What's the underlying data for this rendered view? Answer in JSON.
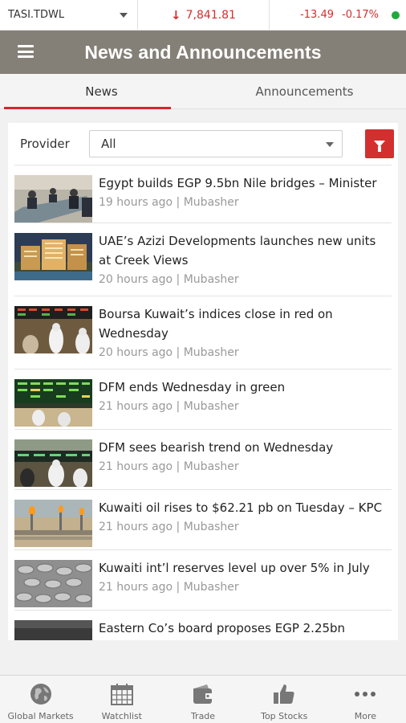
{
  "ticker": {
    "symbol": "TASI.TDWL",
    "index_value": "7,841.81",
    "change": "-13.49",
    "change_pct": "-0.17%",
    "down_color": "#d32f2f",
    "status_color": "#22a83a"
  },
  "appbar": {
    "title": "News and Announcements",
    "background": "#858077"
  },
  "tabs": [
    {
      "label": "News",
      "active": true
    },
    {
      "label": "Announcements",
      "active": false
    }
  ],
  "filter": {
    "provider_label": "Provider",
    "provider_value": "All"
  },
  "news": [
    {
      "headline": "Egypt builds EGP 9.5bn Nile bridges – Minister",
      "meta": "19 hours ago | Mubasher",
      "icon": "meeting-photo"
    },
    {
      "headline": "UAE’s Azizi Developments launches new units at Creek Views",
      "meta": "20 hours ago | Mubasher",
      "icon": "building-photo"
    },
    {
      "headline": "Boursa Kuwait’s indices close in red on Wednesday",
      "meta": "20 hours ago | Mubasher",
      "icon": "trading-floor-photo"
    },
    {
      "headline": "DFM ends Wednesday in green",
      "meta": "21 hours ago | Mubasher",
      "icon": "stock-board-photo"
    },
    {
      "headline": "DFM sees bearish trend on Wednesday",
      "meta": "21 hours ago | Mubasher",
      "icon": "stock-board-photo"
    },
    {
      "headline": "Kuwaiti oil rises to $62.21 pb on Tuesday – KPC",
      "meta": "21 hours ago | Mubasher",
      "icon": "oil-field-photo"
    },
    {
      "headline": "Kuwaiti int’l reserves level up over 5% in July",
      "meta": "21 hours ago | Mubasher",
      "icon": "coins-photo"
    },
    {
      "headline": "Eastern Co’s board proposes EGP 2.25bn",
      "meta": "",
      "icon": "factory-photo"
    }
  ],
  "bottom_nav": [
    {
      "label": "Global Markets",
      "icon": "globe-icon"
    },
    {
      "label": "Watchlist",
      "icon": "calendar-grid-icon"
    },
    {
      "label": "Trade",
      "icon": "wallet-icon"
    },
    {
      "label": "Top Stocks",
      "icon": "thumbs-up-icon"
    },
    {
      "label": "More",
      "icon": "more-dots-icon"
    }
  ]
}
